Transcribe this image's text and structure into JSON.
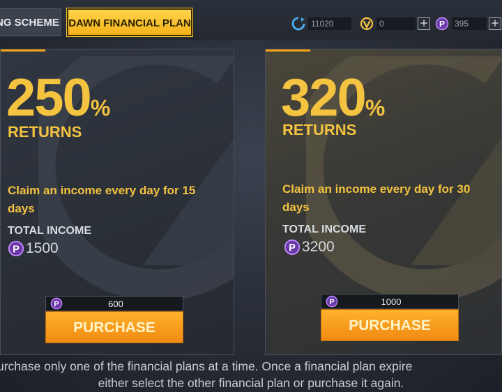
{
  "tabs": [
    {
      "label": "NG SCHEME"
    },
    {
      "label": "DAWN FINANCIAL PLAN"
    }
  ],
  "currencies": [
    {
      "icon": "refresh-coin-icon",
      "value": "11020"
    },
    {
      "icon": "v-coin-icon",
      "value": "0"
    },
    {
      "icon": "p-coin-icon",
      "value": "395"
    }
  ],
  "plus_label": "+",
  "plans": [
    {
      "percent": "250",
      "percent_sign": "%",
      "returns_label": "RETURNS",
      "claim_text": "Claim an income every day for 15 days",
      "total_income_label": "TOTAL INCOME",
      "total_income_value": "1500",
      "cost": "600",
      "purchase_label": "PURCHASE"
    },
    {
      "percent": "320",
      "percent_sign": "%",
      "returns_label": "RETURNS",
      "claim_text": "Claim an income every day for 30 days",
      "total_income_label": "TOTAL INCOME",
      "total_income_value": "3200",
      "cost": "1000",
      "purchase_label": "PURCHASE"
    }
  ],
  "footer": {
    "line1": "urchase only one of the financial plans at a time. Once a financial plan expire",
    "line2": "either select the other financial plan or purchase it again."
  },
  "colors": {
    "accent_gold": "#f4c340",
    "button_orange": "#f39a1a",
    "p_coin_purple": "#a45ee8"
  }
}
